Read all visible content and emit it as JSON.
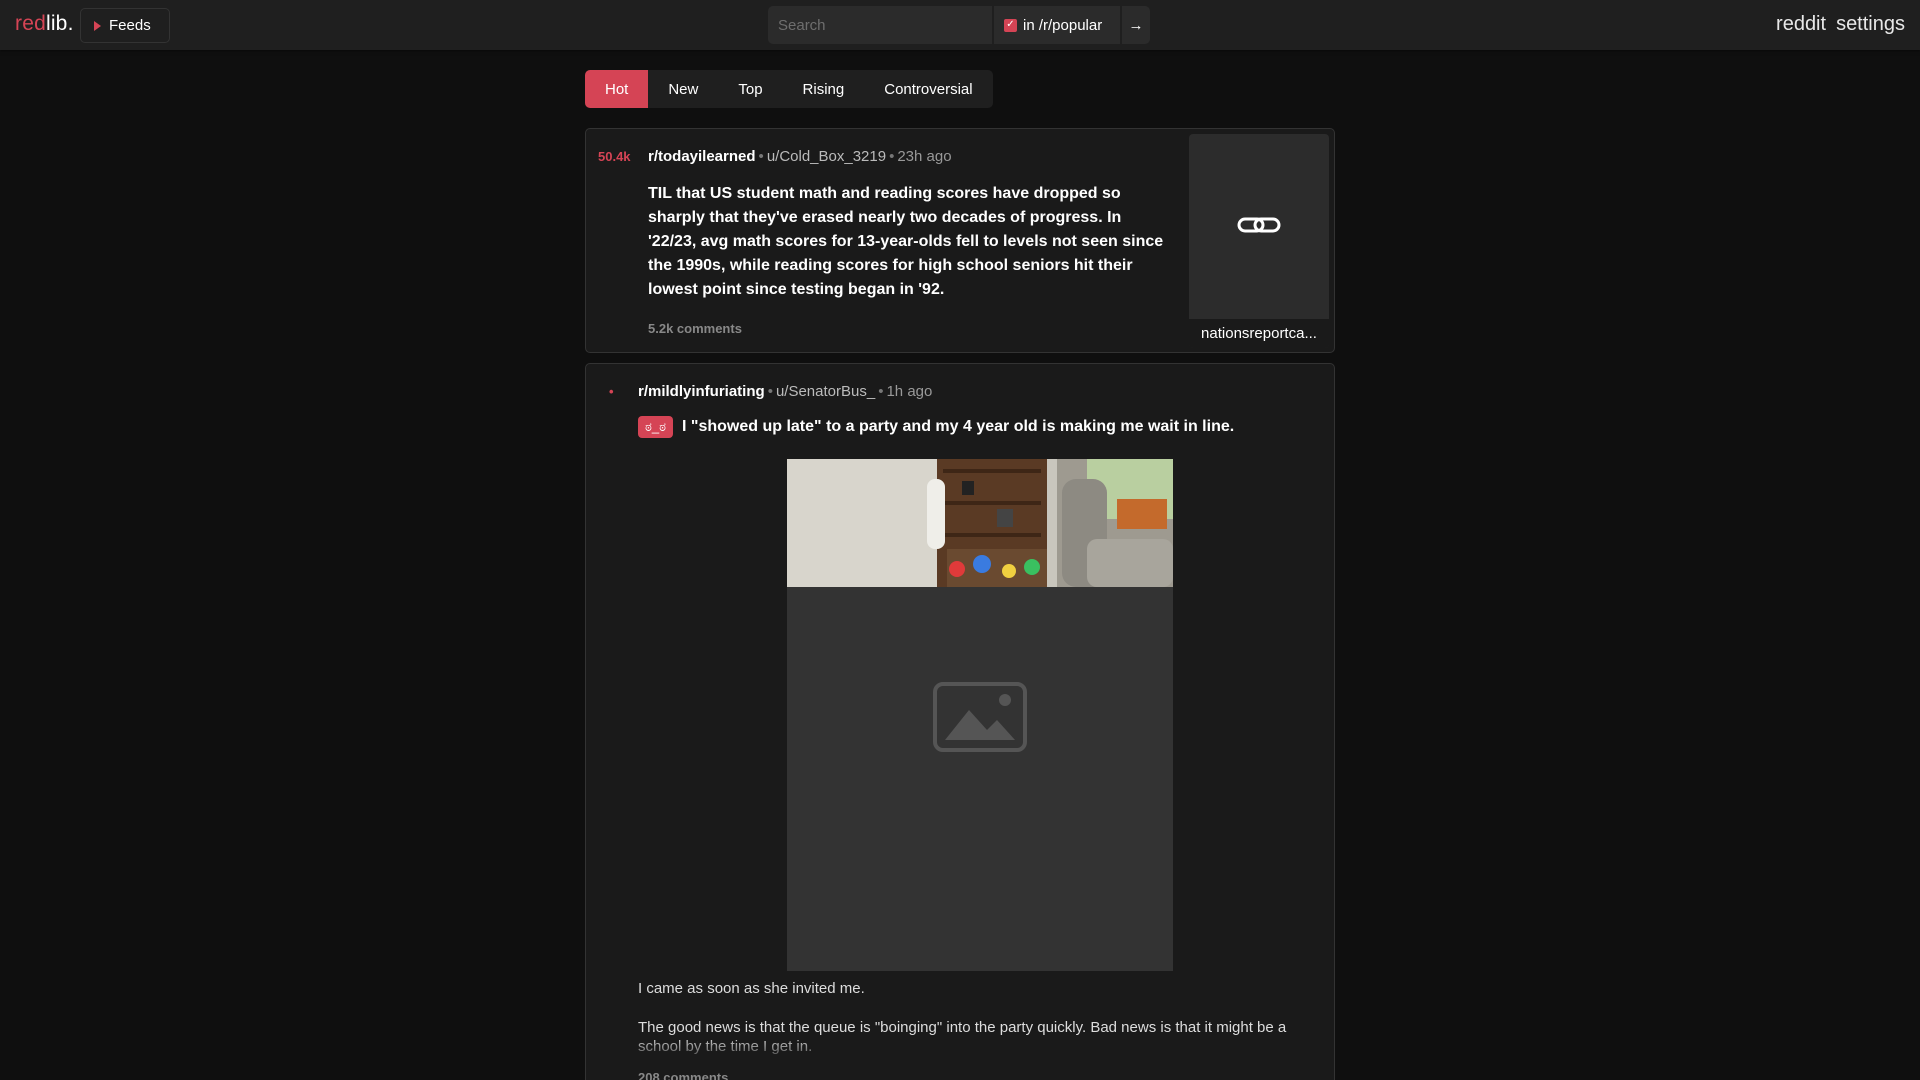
{
  "nav": {
    "logo_red": "red",
    "logo_white": "lib.",
    "feeds_label": "Feeds",
    "search_placeholder": "Search",
    "scope_label": "in /r/popular",
    "go_label": "→",
    "links": [
      "reddit",
      "settings"
    ]
  },
  "sort": {
    "tabs": [
      "Hot",
      "New",
      "Top",
      "Rising",
      "Controversial"
    ],
    "active": "Hot"
  },
  "posts": [
    {
      "score": "50.4k",
      "subreddit": "r/todayilearned",
      "author": "u/Cold_Box_3219",
      "age": "23h ago",
      "title": "TIL that US student math and reading scores have dropped so sharply that they've erased nearly two decades of progress. In '22/23, avg math scores for 13-year-olds fell to levels not seen since the 1990s, while reading scores for high school seniors hit their lowest point since testing began in '92.",
      "comments": "5.2k comments",
      "thumbnail_domain": "nationsreportca..."
    },
    {
      "score": "•",
      "subreddit": "r/mildlyinfuriating",
      "author": "u/SenatorBus_",
      "age": "1h ago",
      "flair": "ಠ_ಠ",
      "title": "I \"showed up late\" to a party and my 4 year old is making me wait in line.",
      "body": [
        "I came as soon as she invited me.",
        "The good news is that the queue is \"boinging\" into the party quickly. Bad news is that it might be a school by the time I get in."
      ],
      "comments": "208 comments"
    }
  ],
  "colors": {
    "accent": "#d54455",
    "background": "#0f0f0f",
    "nav_bg": "#1f1f1f",
    "post_bg": "#1a1a1a"
  }
}
